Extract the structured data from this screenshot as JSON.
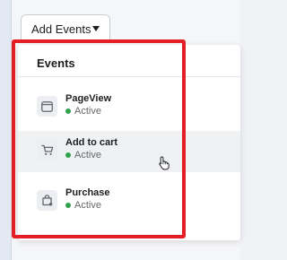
{
  "toolbar": {
    "add_events_label": "Add Events",
    "caret_icon": "chevron-down-icon"
  },
  "dropdown": {
    "header": "Events",
    "items": [
      {
        "name": "PageView",
        "status": "Active",
        "icon": "browser-window-icon"
      },
      {
        "name": "Add to cart",
        "status": "Active",
        "icon": "shopping-cart-icon"
      },
      {
        "name": "Purchase",
        "status": "Active",
        "icon": "shopping-bag-icon"
      }
    ]
  },
  "colors": {
    "highlight": "#e31e24",
    "status_active": "#31a24c",
    "hover_bg": "#f0f1f3"
  }
}
